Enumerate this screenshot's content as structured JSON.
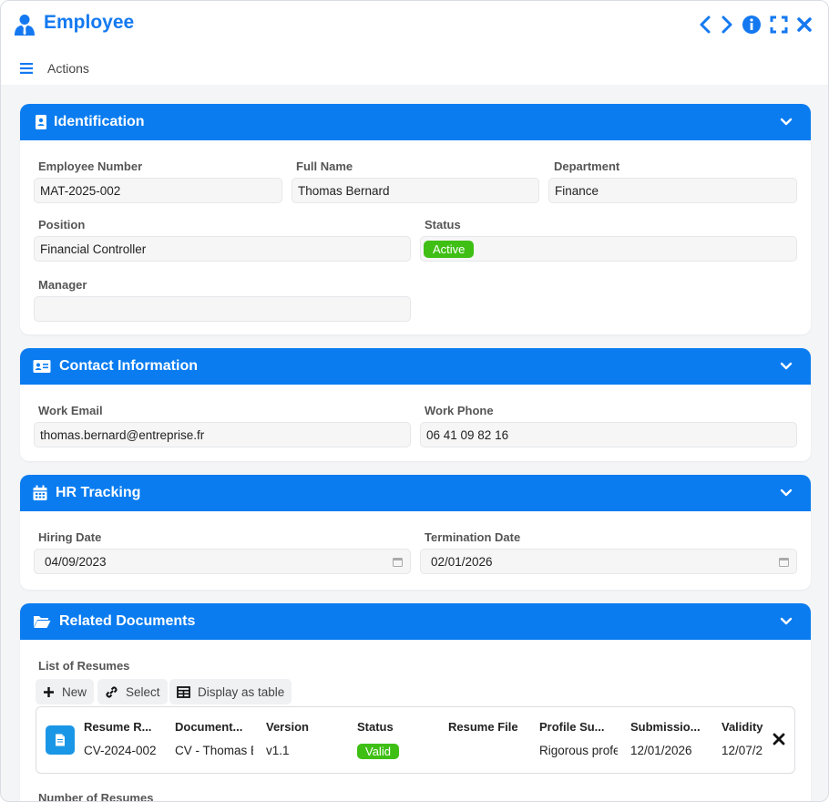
{
  "window": {
    "title": "Employee",
    "accent": "#1479f0"
  },
  "actionbar": {
    "actions_label": "Actions"
  },
  "identification": {
    "title": "Identification",
    "employee_number": {
      "label": "Employee Number",
      "value": "MAT-2025-002"
    },
    "full_name": {
      "label": "Full Name",
      "value": "Thomas Bernard"
    },
    "department": {
      "label": "Department",
      "value": "Finance"
    },
    "position": {
      "label": "Position",
      "value": "Financial Controller"
    },
    "status": {
      "label": "Status",
      "value": "Active",
      "color": "#3fbf14"
    },
    "manager": {
      "label": "Manager",
      "value": ""
    }
  },
  "contact": {
    "title": "Contact Information",
    "work_email": {
      "label": "Work Email",
      "value": "thomas.bernard@entreprise.fr"
    },
    "work_phone": {
      "label": "Work Phone",
      "value": "06 41 09 82 16"
    }
  },
  "hr": {
    "title": "HR Tracking",
    "hiring_date": {
      "label": "Hiring Date",
      "value": "04/09/2023"
    },
    "termination_date": {
      "label": "Termination Date",
      "value": "02/01/2026"
    }
  },
  "documents": {
    "title": "Related Documents",
    "list_label": "List of Resumes",
    "toolbar": {
      "new_label": "New",
      "select_label": "Select",
      "table_label": "Display as table"
    },
    "columns": [
      "Resume R...",
      "Document...",
      "Version",
      "Status",
      "Resume File",
      "Profile Su...",
      "Submissio...",
      "Validity"
    ],
    "row": {
      "resume_ref": "CV-2024-002",
      "document": "CV - Thomas B",
      "version": "v1.1",
      "status": "Valid",
      "resume_file": "",
      "profile_summary": "Rigorous profe",
      "submission": "12/01/2026",
      "validity": "12/07/2"
    },
    "count_label": "Number of Resumes"
  }
}
